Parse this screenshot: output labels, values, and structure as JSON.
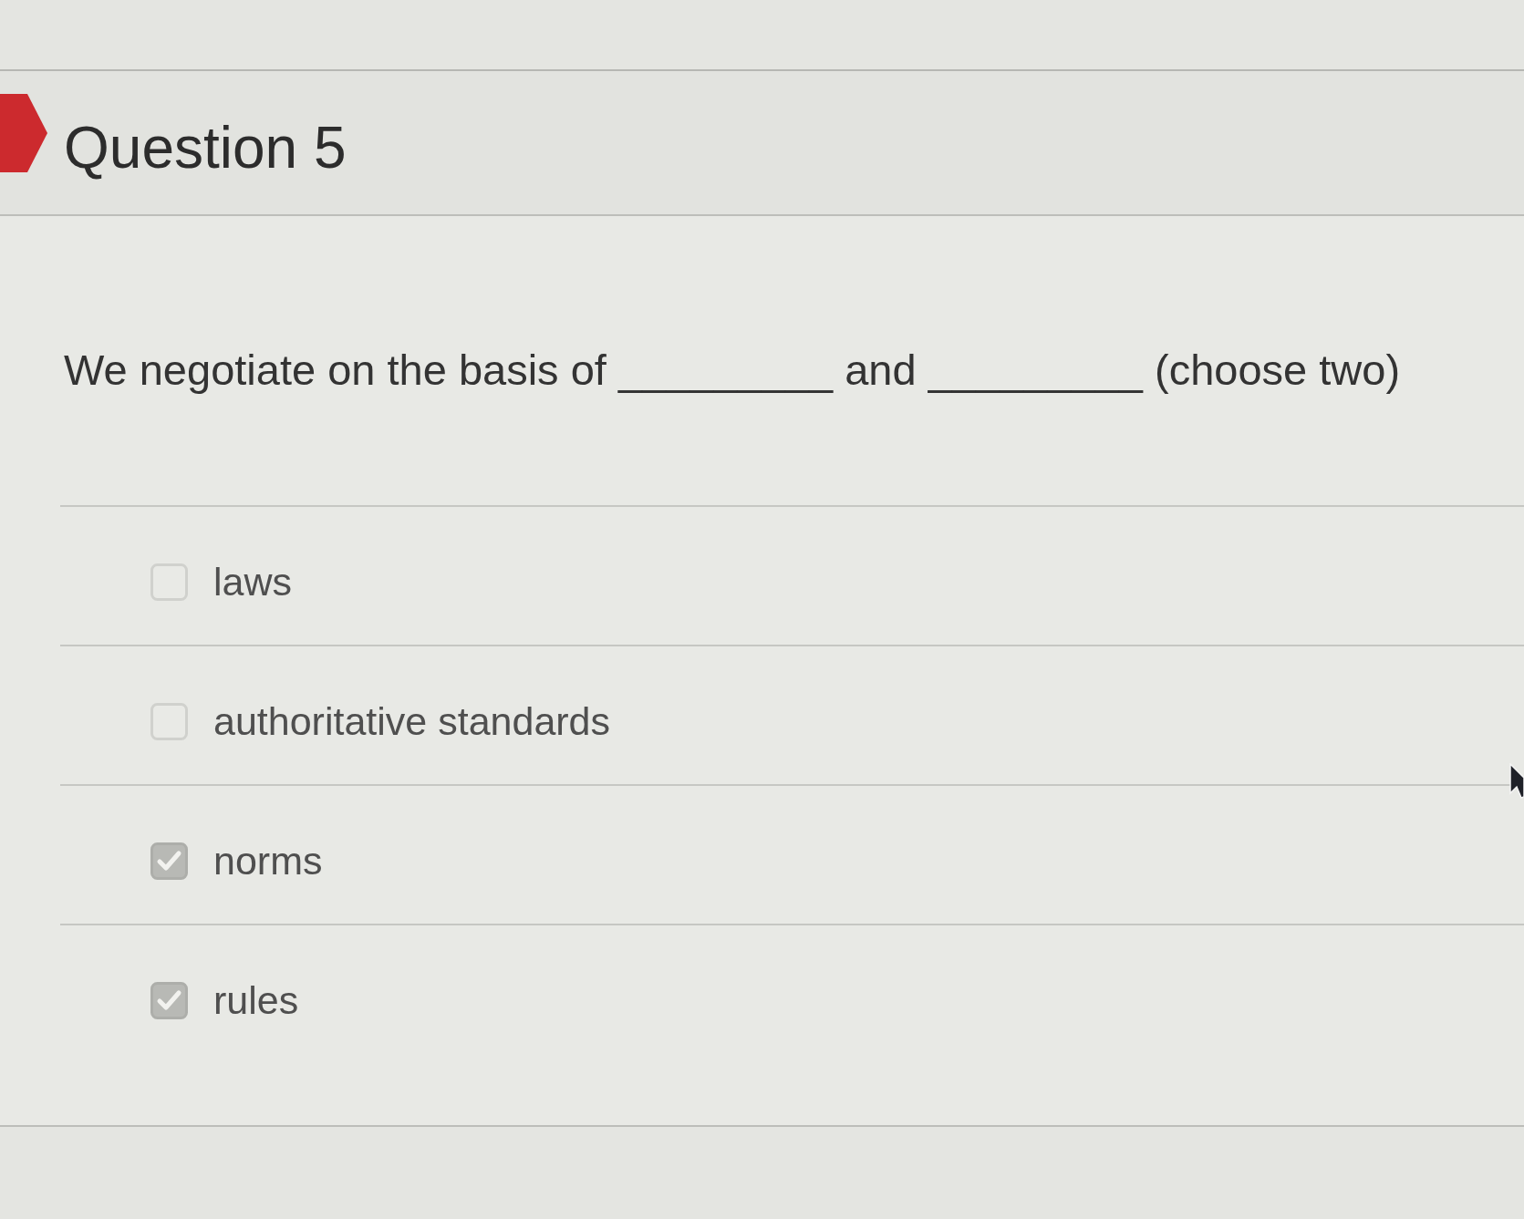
{
  "question": {
    "title": "Question 5",
    "text": "We negotiate on the basis of _________ and _________ (choose two)",
    "options": [
      {
        "label": "laws",
        "checked": false
      },
      {
        "label": "authoritative standards",
        "checked": false
      },
      {
        "label": "norms",
        "checked": true
      },
      {
        "label": "rules",
        "checked": true
      }
    ]
  }
}
